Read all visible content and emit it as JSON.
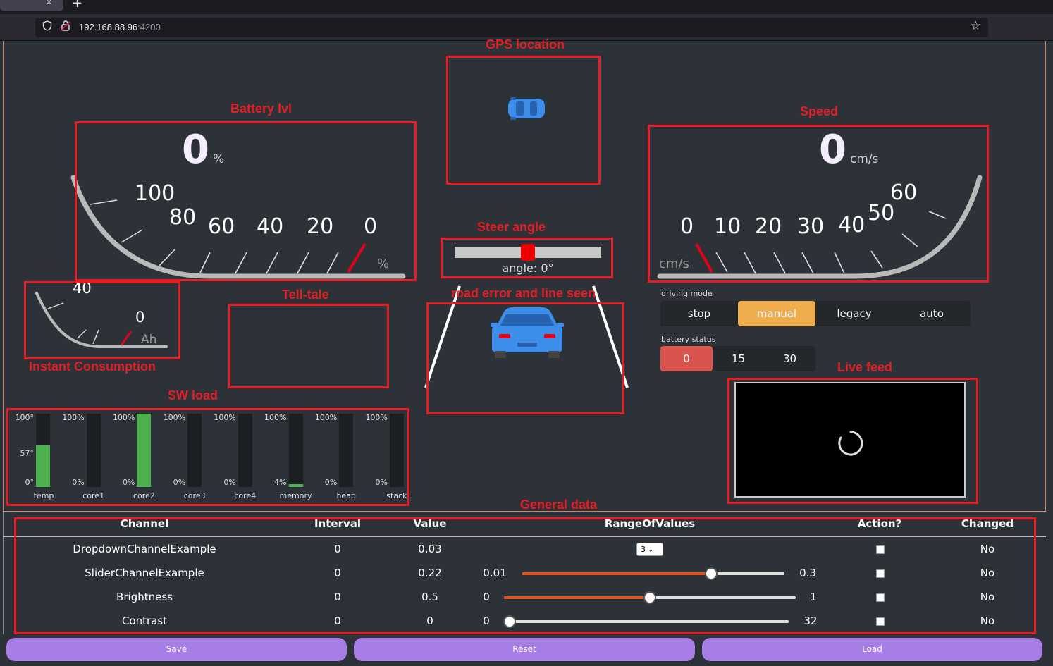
{
  "browser": {
    "url_host": "192.168.88.96",
    "url_port": ":4200",
    "tab_close": "×",
    "new_tab": "+",
    "star": "☆"
  },
  "annotations": {
    "gps": "GPS location",
    "battery": "Battery lvl",
    "speed": "Speed",
    "steer": "Steer angle",
    "telltale": "Tell-tale",
    "road": "road error and line seen",
    "instant": "Instant Consumption",
    "swload": "SW load",
    "livefeed": "Live feed",
    "general": "General data"
  },
  "battery_gauge": {
    "value": "0",
    "unit": "%",
    "scale_unit": "%",
    "ticks": [
      "100",
      "80",
      "60",
      "40",
      "20",
      "0"
    ]
  },
  "speed_gauge": {
    "value": "0",
    "unit": "cm/s",
    "scale_unit": "cm/s",
    "ticks": [
      "0",
      "10",
      "20",
      "30",
      "40",
      "50",
      "60"
    ]
  },
  "consumption_gauge": {
    "ticks": [
      "40",
      "0"
    ],
    "unit": "Ah"
  },
  "steer": {
    "label": "angle: 0°",
    "value_fraction": 0.5
  },
  "driving_mode": {
    "label": "driving mode",
    "options": [
      "stop",
      "manual",
      "legacy",
      "auto"
    ],
    "selected": "manual"
  },
  "battery_status": {
    "label": "battery status",
    "options": [
      "0",
      "15",
      "30"
    ],
    "selected": "0"
  },
  "sw_load": [
    {
      "name": "temp",
      "top": "100°",
      "mid": "57°",
      "bottom": "0°",
      "fraction": 0.57
    },
    {
      "name": "core1",
      "top": "100%",
      "bottom": "0%",
      "fraction": 0
    },
    {
      "name": "core2",
      "top": "100%",
      "bottom": "0%",
      "fraction": 1
    },
    {
      "name": "core3",
      "top": "100%",
      "bottom": "0%",
      "fraction": 0
    },
    {
      "name": "core4",
      "top": "100%",
      "bottom": "0%",
      "fraction": 0
    },
    {
      "name": "memory",
      "top": "100%",
      "bottom": "4%",
      "fraction": 0.04
    },
    {
      "name": "heap",
      "top": "100%",
      "bottom": "0%",
      "fraction": 0
    },
    {
      "name": "stack",
      "top": "100%",
      "bottom": "0%",
      "fraction": 0
    }
  ],
  "table": {
    "headers": [
      "Channel",
      "Interval",
      "Value",
      "RangeOfValues",
      "Action?",
      "Changed"
    ],
    "rows": [
      {
        "channel": "DropdownChannelExample",
        "interval": "0",
        "value": "0.03",
        "dropdown": "3",
        "changed": "No"
      },
      {
        "channel": "SliderChannelExample",
        "interval": "0",
        "value": "0.22",
        "min": "0.01",
        "max": "0.3",
        "fraction": 0.72,
        "changed": "No"
      },
      {
        "channel": "Brightness",
        "interval": "0",
        "value": "0.5",
        "min": "0",
        "max": "1",
        "fraction": 0.5,
        "changed": "No"
      },
      {
        "channel": "Contrast",
        "interval": "0",
        "value": "0",
        "min": "0",
        "max": "32",
        "fraction": 0,
        "changed": "No"
      }
    ]
  },
  "buttons": {
    "save": "Save",
    "reset": "Reset",
    "load": "Load"
  },
  "colors": {
    "annotation": "#e31e24",
    "accent_orange": "#f0ad4e",
    "danger": "#d9534f",
    "bar_green": "#4cb04f",
    "slider_fill": "#e55319",
    "button_purple": "#a67ee5"
  }
}
